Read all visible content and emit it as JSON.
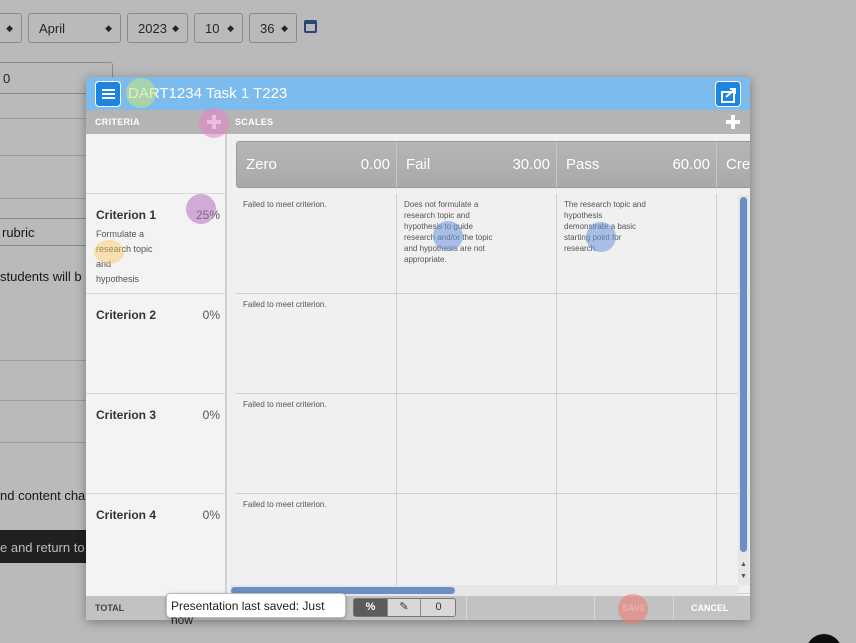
{
  "background": {
    "selects": [
      {
        "value": "",
        "name": "bg-select-day"
      },
      {
        "value": "April",
        "name": "bg-select-month"
      },
      {
        "value": "2023",
        "name": "bg-select-year"
      },
      {
        "value": "10",
        "name": "bg-select-hour"
      },
      {
        "value": "36",
        "name": "bg-select-minute"
      }
    ],
    "input_value": "0",
    "text_rubric": "rubric",
    "text_students": "students will b",
    "text_content": "nd content cha",
    "button_label": "e and return to"
  },
  "modal": {
    "title": "DART1234 Task 1 T223",
    "criteria_header": "CRITERIA",
    "scales_header": "SCALES",
    "scales": [
      {
        "name": "Zero",
        "points": "0.00"
      },
      {
        "name": "Fail",
        "points": "30.00"
      },
      {
        "name": "Pass",
        "points": "60.00"
      },
      {
        "name": "Cre",
        "points": ""
      }
    ],
    "criteria": [
      {
        "name": "Criterion 1",
        "weight": "25%",
        "description": "Formulate a research topic and hypothesis",
        "cells": [
          "Failed to meet criterion.",
          "Does not formulate a research topic and hypothesis to guide research and/or the topic and hypothesis are not appropriate.",
          "The research topic and hypothesis demonstrate a basic starting point for research.",
          ""
        ]
      },
      {
        "name": "Criterion 2",
        "weight": "0%",
        "description": "",
        "cells": [
          "Failed to meet criterion.",
          "",
          "",
          ""
        ]
      },
      {
        "name": "Criterion 3",
        "weight": "0%",
        "description": "",
        "cells": [
          "Failed to meet criterion.",
          "",
          "",
          ""
        ]
      },
      {
        "name": "Criterion 4",
        "weight": "0%",
        "description": "",
        "cells": [
          "Failed to meet criterion.",
          "",
          "",
          ""
        ]
      }
    ],
    "footer": {
      "total_label": "TOTAL",
      "toggle_percent": "%",
      "toggle_zero": "0",
      "save_label": "SAVE",
      "cancel_label": "CANCEL"
    },
    "tooltip": "Presentation last saved: Just now"
  },
  "colors": {
    "titlebar": "#7cbbee",
    "accent_button": "#1d84e0",
    "scrollbar": "#6b8fc5",
    "header_bar": "#b4b4b4"
  },
  "icons": [
    "menu-list-icon",
    "share-export-icon",
    "add-criterion-icon",
    "add-scale-icon",
    "calendar-icon",
    "edit-icon"
  ]
}
